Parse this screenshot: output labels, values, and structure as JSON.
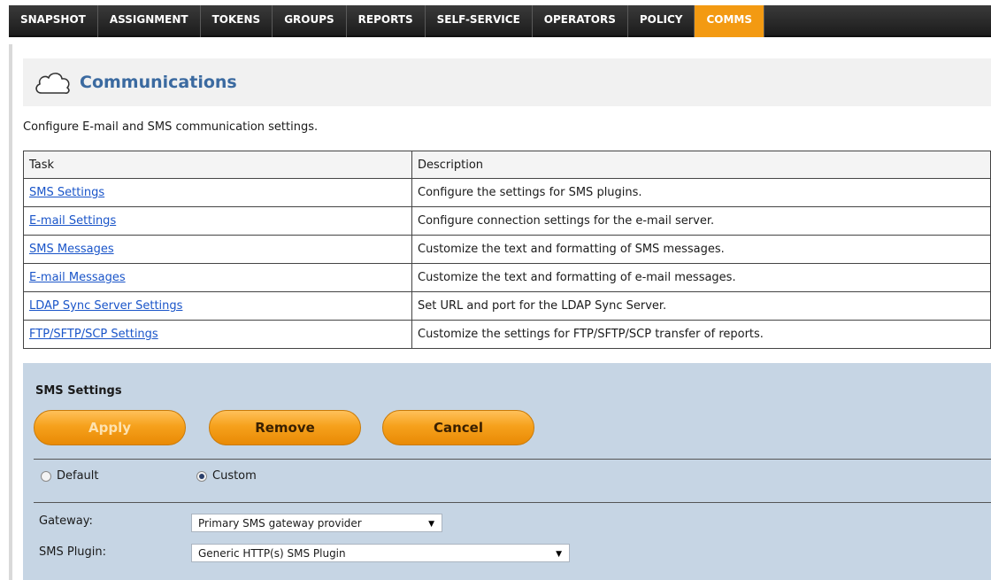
{
  "nav": {
    "tabs": [
      {
        "label": "SNAPSHOT"
      },
      {
        "label": "ASSIGNMENT"
      },
      {
        "label": "TOKENS"
      },
      {
        "label": "GROUPS"
      },
      {
        "label": "REPORTS"
      },
      {
        "label": "SELF-SERVICE"
      },
      {
        "label": "OPERATORS"
      },
      {
        "label": "POLICY"
      },
      {
        "label": "COMMS"
      }
    ],
    "active_tab": "COMMS",
    "active_color": "#f39a12"
  },
  "header": {
    "icon": "cloud-icon",
    "title": "Communications"
  },
  "intro": "Configure E-mail and SMS communication settings.",
  "table": {
    "columns": [
      "Task",
      "Description"
    ],
    "rows": [
      {
        "task": "SMS Settings",
        "description": "Configure the settings for SMS plugins."
      },
      {
        "task": "E-mail Settings",
        "description": "Configure connection settings for the e-mail server."
      },
      {
        "task": "SMS Messages",
        "description": "Customize the text and formatting of SMS messages."
      },
      {
        "task": "E-mail Messages",
        "description": "Customize the text and formatting of e-mail messages."
      },
      {
        "task": "LDAP Sync Server Settings",
        "description": "Set URL and port for the LDAP Sync Server."
      },
      {
        "task": "FTP/SFTP/SCP Settings",
        "description": "Customize the settings for FTP/SFTP/SCP transfer of reports."
      }
    ]
  },
  "sms_settings": {
    "title": "SMS Settings",
    "buttons": {
      "apply": "Apply",
      "remove": "Remove",
      "cancel": "Cancel"
    },
    "mode": {
      "default_label": "Default",
      "custom_label": "Custom",
      "selected": "Custom"
    },
    "gateway": {
      "label": "Gateway:",
      "value": "Primary SMS gateway provider"
    },
    "plugin": {
      "label": "SMS Plugin:",
      "value": "Generic HTTP(s) SMS Plugin"
    }
  }
}
